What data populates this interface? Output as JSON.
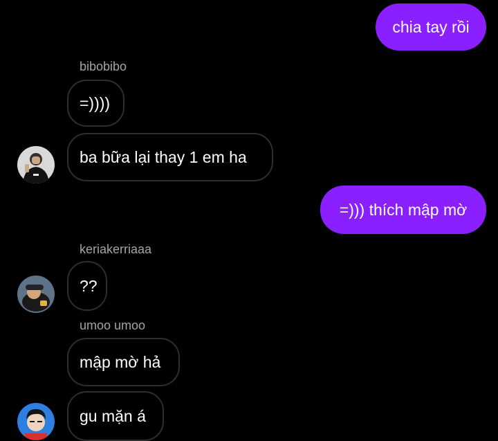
{
  "thread": {
    "messages": [
      {
        "direction": "out",
        "text": "chia tay rồi"
      },
      {
        "direction": "in",
        "sender": "bibobibo",
        "text": "=))))"
      },
      {
        "direction": "in",
        "text": "ba bữa lại thay 1 em ha"
      },
      {
        "direction": "out",
        "text": "=))) thích mập mờ"
      },
      {
        "direction": "in",
        "sender": "keriakerriaaa",
        "text": "??"
      },
      {
        "direction": "in",
        "sender": "umoo umoo",
        "text": "mập mờ hả"
      },
      {
        "direction": "in",
        "text": "gu mặn á"
      }
    ]
  },
  "colors": {
    "background": "#000000",
    "outgoing_bubble": "#8a1fff",
    "incoming_border": "#2e2e2e",
    "sender_text": "#a3a3a3"
  }
}
